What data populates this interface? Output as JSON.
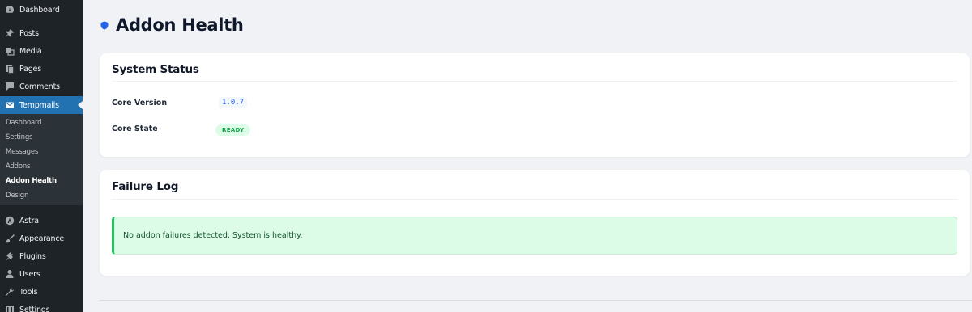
{
  "sidebar": {
    "dashboard": {
      "label": "Dashboard",
      "icon": "dashboard-icon"
    },
    "posts": {
      "label": "Posts",
      "icon": "pin-icon"
    },
    "media": {
      "label": "Media",
      "icon": "media-icon"
    },
    "pages": {
      "label": "Pages",
      "icon": "pages-icon"
    },
    "comments": {
      "label": "Comments",
      "icon": "comment-icon"
    },
    "tempmails": {
      "label": "Tempmails",
      "icon": "mail-icon"
    },
    "submenu": [
      "Dashboard",
      "Settings",
      "Messages",
      "Addons",
      "Addon Health",
      "Design"
    ],
    "astra": {
      "label": "Astra",
      "icon": "astra-icon"
    },
    "appearance": {
      "label": "Appearance",
      "icon": "brush-icon"
    },
    "plugins": {
      "label": "Plugins",
      "icon": "plug-icon"
    },
    "users": {
      "label": "Users",
      "icon": "user-icon"
    },
    "tools": {
      "label": "Tools",
      "icon": "wrench-icon"
    },
    "settings": {
      "label": "Settings",
      "icon": "settings-icon"
    }
  },
  "page": {
    "title": "Addon Health"
  },
  "system_status": {
    "title": "System Status",
    "core_version_label": "Core Version",
    "core_version_value": "1.0.7",
    "core_state_label": "Core State",
    "core_state_value": "READY"
  },
  "failure_log": {
    "title": "Failure Log",
    "message": "No addon failures detected. System is healthy."
  },
  "colors": {
    "sidebar_bg": "#1d2327",
    "active": "#2271b1",
    "success_bg": "#dcfce7",
    "success_border": "#22c55e",
    "version_text": "#2563eb"
  }
}
